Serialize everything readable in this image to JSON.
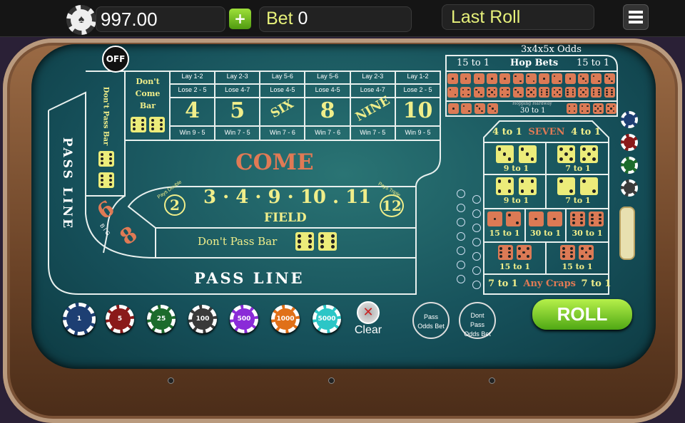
{
  "topbar": {
    "balance": "997.00",
    "add_label": "+",
    "bet_label": "Bet",
    "bet_value": "0",
    "last_roll_label": "Last Roll"
  },
  "table": {
    "off_label": "OFF",
    "odds_label": "3x4x5x Odds",
    "pass_line_vertical": "PASS LINE",
    "dont_pass_bar_vertical": "Don't Pass Bar",
    "dont_come_bar": [
      "Don't",
      "Come",
      "Bar"
    ],
    "come": "COME",
    "field": {
      "numbers": "3 · 4 · 9 · 10 . 11",
      "label": "FIELD",
      "two": "2",
      "pays_double": "Pays Double",
      "twelve": "12",
      "pays_triple": "Pays Triple"
    },
    "dont_pass_bar": "Don't Pass Bar",
    "pass_line": "PASS LINE",
    "big": {
      "six": "6",
      "eight": "8",
      "big": "B I G"
    },
    "numbers": [
      {
        "lay": "Lay 1-2",
        "lose": "Lose 2 - 5",
        "label": "4",
        "win": "Win 9 - 5"
      },
      {
        "lay": "Lay 2-3",
        "lose": "Lose 4-7",
        "label": "5",
        "win": "Win 7 - 5"
      },
      {
        "lay": "Lay 5-6",
        "lose": "Lose 4-5",
        "label": "SIX",
        "win": "Win 7 - 6"
      },
      {
        "lay": "Lay 5-6",
        "lose": "Lose 4-5",
        "label": "8",
        "win": "Win 7 - 6"
      },
      {
        "lay": "Lay 2-3",
        "lose": "Lose 4-7",
        "label": "NINE",
        "win": "Win 7 - 5"
      },
      {
        "lay": "Lay 1-2",
        "lose": "Lose 2 - 5",
        "label": "10",
        "win": "Win 9 - 5"
      }
    ],
    "hop": {
      "title": "Hop Bets",
      "left_odds": "15 to 1",
      "right_odds": "15 to 1",
      "hardway_label": "Hopping Hardway",
      "hardway_odds": "30 to 1",
      "top": [
        1,
        1,
        1,
        1,
        1,
        2,
        2,
        1,
        2,
        1,
        3,
        2,
        3
      ],
      "bottom": [
        2,
        4,
        3,
        5,
        4,
        3,
        5,
        6,
        5,
        6,
        5,
        6,
        6
      ],
      "left": [
        1,
        2,
        3,
        3
      ],
      "right": [
        4,
        4,
        5,
        5
      ]
    },
    "props": {
      "seven_left": "4 to 1",
      "seven": "SEVEN",
      "seven_right": "4 to 1",
      "hardways": [
        {
          "dice": [
            3,
            3
          ],
          "odds": "9 to 1"
        },
        {
          "dice": [
            5,
            5
          ],
          "odds": "7 to 1"
        },
        {
          "dice": [
            4,
            4
          ],
          "odds": "9 to 1"
        },
        {
          "dice": [
            2,
            2
          ],
          "odds": "7 to 1"
        }
      ],
      "craps": [
        {
          "dice": [
            1,
            2
          ],
          "odds": "15 to 1"
        },
        {
          "dice": [
            1,
            1
          ],
          "odds": "30 to 1"
        },
        {
          "dice": [
            6,
            6
          ],
          "odds": "30 to 1"
        },
        {
          "dice": [
            6,
            5
          ],
          "odds": "15 to 1"
        },
        {
          "dice": [
            6,
            5
          ],
          "odds": "15 to 1"
        }
      ],
      "any_left": "7 to 1",
      "any_craps": "Any Craps",
      "any_right": "7 to 1"
    }
  },
  "chips": [
    {
      "value": "1",
      "color": "#1d3f73"
    },
    {
      "value": "5",
      "color": "#8a1a1a"
    },
    {
      "value": "25",
      "color": "#1d6b2c"
    },
    {
      "value": "100",
      "color": "#3a3a3a"
    },
    {
      "value": "500",
      "color": "#8a2bd8"
    },
    {
      "value": "1000",
      "color": "#e07018"
    },
    {
      "value": "5000",
      "color": "#2cc6c6"
    }
  ],
  "side_chips": [
    "#1d3f73",
    "#8a1a1a",
    "#1d6b2c",
    "#3a3a3a"
  ],
  "clear_label": "Clear",
  "pass_odds_label": "Pass Odds Bet",
  "dont_pass_odds_label": "Dont Pass Odds Bet",
  "roll_label": "ROLL"
}
